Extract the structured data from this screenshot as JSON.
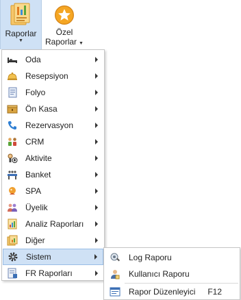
{
  "ribbon": {
    "raporlar": {
      "label": "Raporlar",
      "icon": "reports-icon"
    },
    "ozel": {
      "label_line1": "Özel",
      "label_line2": "Raporlar",
      "icon": "star-icon"
    }
  },
  "menu": {
    "items": [
      {
        "label": "Oda",
        "icon": "bed-icon"
      },
      {
        "label": "Resepsiyon",
        "icon": "bell-icon"
      },
      {
        "label": "Folyo",
        "icon": "document-icon"
      },
      {
        "label": "Ön Kasa",
        "icon": "cash-box-icon"
      },
      {
        "label": "Rezervasyon",
        "icon": "phone-icon"
      },
      {
        "label": "CRM",
        "icon": "people-icon"
      },
      {
        "label": "Aktivite",
        "icon": "ball-icon"
      },
      {
        "label": "Banket",
        "icon": "banquet-icon"
      },
      {
        "label": "SPA",
        "icon": "spa-icon"
      },
      {
        "label": "Üyelik",
        "icon": "members-icon"
      },
      {
        "label": "Analiz Raporları",
        "icon": "analysis-icon"
      },
      {
        "label": "Diğer",
        "icon": "other-icon"
      },
      {
        "label": "Sistem",
        "icon": "gear-icon"
      },
      {
        "label": "FR Raporları",
        "icon": "fr-report-icon"
      }
    ],
    "highlighted": "Sistem"
  },
  "submenu": {
    "items": [
      {
        "label": "Log Raporu",
        "icon": "log-icon",
        "shortcut": ""
      },
      {
        "label": "Kullanıcı Raporu",
        "icon": "user-icon",
        "shortcut": ""
      },
      {
        "label": "Rapor Düzenleyici",
        "icon": "editor-icon",
        "shortcut": "F12"
      }
    ]
  },
  "colors": {
    "highlight": "#cfe1f5",
    "highlight_border": "#99bde6",
    "accent_orange": "#f5a623"
  }
}
